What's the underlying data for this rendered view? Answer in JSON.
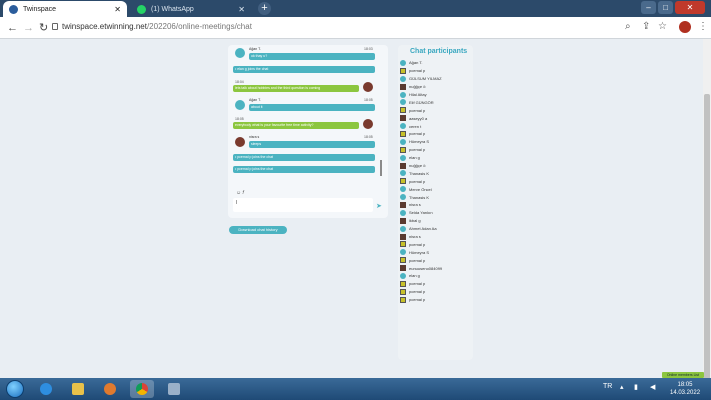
{
  "browser": {
    "tabs": [
      {
        "title": "Twinspace",
        "active": true
      },
      {
        "title": "(1) WhatsApp",
        "active": false
      }
    ],
    "url_host": "twinspace.etwinning.net",
    "url_path": "/202206/online-meetings/chat"
  },
  "chat": {
    "messages": [
      {
        "user": "Ağan T.",
        "time": "18:03",
        "text": "ok thay u?",
        "style": "teal"
      },
      {
        "text": "• elan g joins the chat",
        "style": "teal"
      },
      {
        "time": "18:04",
        "text": "lets talk about hobbies and the third question is coming",
        "style": "green"
      },
      {
        "user": "Ağan T.",
        "time": "18:05",
        "text": "about it",
        "style": "teal"
      },
      {
        "time": "18:05",
        "text": "everybody what is your favourite free time activity?",
        "style": "green"
      },
      {
        "user": "nisra s",
        "time": "18:05",
        "text": "sleeps",
        "style": "teal"
      },
      {
        "text": "• pcemal p joins the chat",
        "style": "teal"
      },
      {
        "text": "• pcemal p joins the chat",
        "style": "teal"
      }
    ],
    "input_value": "l",
    "input_icons": "☺ 𝑓",
    "download_label": "Download chat history"
  },
  "participants": {
    "title": "Chat participants",
    "items": [
      {
        "name": "Ağan T.",
        "av": "teal"
      },
      {
        "name": "pcemal p",
        "av": "yellow"
      },
      {
        "name": "GÜLSUM YILMAZ",
        "av": "teal"
      },
      {
        "name": "nuğğçe ö",
        "av": "dark"
      },
      {
        "name": "Hilal Altay",
        "av": "teal"
      },
      {
        "name": "Elif GÜNGÖR",
        "av": "teal"
      },
      {
        "name": "pcemal p",
        "av": "yellow"
      },
      {
        "name": "aaseyy0 a",
        "av": "dark"
      },
      {
        "name": "ceren t",
        "av": "teal"
      },
      {
        "name": "pcemal p",
        "av": "yellow"
      },
      {
        "name": "Hümeyra S",
        "av": "teal"
      },
      {
        "name": "pcemal p",
        "av": "yellow"
      },
      {
        "name": "elan g",
        "av": "teal"
      },
      {
        "name": "nuğğçe ö",
        "av": "dark"
      },
      {
        "name": "Thanasis K",
        "av": "teal"
      },
      {
        "name": "pcemal p",
        "av": "yellow"
      },
      {
        "name": "Merve Öncel",
        "av": "teal"
      },
      {
        "name": "Thanasis K",
        "av": "teal"
      },
      {
        "name": "nisra s",
        "av": "dark"
      },
      {
        "name": "Selda Yarıkın",
        "av": "teal"
      },
      {
        "name": "ikbal g",
        "av": "dark"
      },
      {
        "name": "Ahmet Adan Aa",
        "av": "teal"
      },
      {
        "name": "nisra s",
        "av": "dark"
      },
      {
        "name": "pcemal p",
        "av": "yellow"
      },
      {
        "name": "Hümeyra S",
        "av": "teal"
      },
      {
        "name": "pcemal p",
        "av": "yellow"
      },
      {
        "name": "eunuuseno084099",
        "av": "dark"
      },
      {
        "name": "elan g",
        "av": "teal"
      },
      {
        "name": "pcemal p",
        "av": "yellow"
      },
      {
        "name": "pcemal p",
        "av": "yellow"
      },
      {
        "name": "pcemal p",
        "av": "yellow"
      }
    ]
  },
  "online_badge": "Online members List",
  "taskbar": {
    "lang": "TR",
    "time": "18:05",
    "date": "14.03.2022"
  }
}
